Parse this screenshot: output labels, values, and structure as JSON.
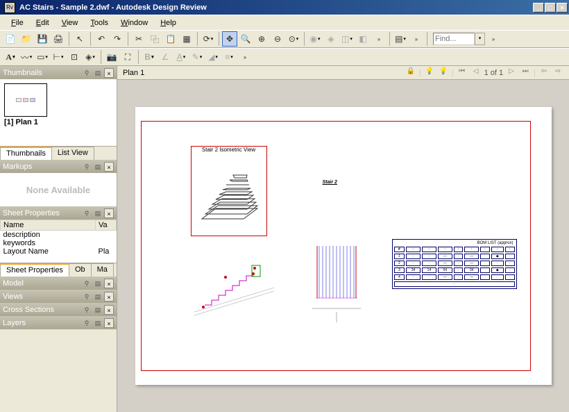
{
  "titlebar": {
    "icon_label": "Rv",
    "text": "AC Stairs - Sample 2.dwf - Autodesk Design Review",
    "min": "_",
    "max": "□",
    "close": "×"
  },
  "menu": {
    "file": "File",
    "edit": "Edit",
    "view": "View",
    "tools": "Tools",
    "window": "Window",
    "help": "Help"
  },
  "find": {
    "placeholder": "Find..."
  },
  "panels": {
    "thumbnails": {
      "title": "Thumbnails",
      "item_label": "[1] Plan 1",
      "tabs": {
        "thumbnails": "Thumbnails",
        "list": "List View"
      }
    },
    "markups": {
      "title": "Markups",
      "body": "None Available"
    },
    "sheet_props": {
      "title": "Sheet Properties",
      "col_name": "Name",
      "col_val": "Va",
      "rows": {
        "r1": "description",
        "r2": "keywords",
        "r3": "Layout Name",
        "r3v": "Pla"
      },
      "tabs": {
        "sp": "Sheet Properties",
        "ob": "Ob",
        "ma": "Ma"
      }
    },
    "model": {
      "title": "Model"
    },
    "views": {
      "title": "Views"
    },
    "cross": {
      "title": "Cross Sections"
    },
    "layers": {
      "title": "Layers"
    }
  },
  "canvas": {
    "title": "Plan 1",
    "page": "1 of 1",
    "drawing": {
      "iso_label": "Stair 2 Isometric View",
      "elev_label": "Stair 2",
      "bom_title": "BOM LIST (approx)"
    }
  }
}
